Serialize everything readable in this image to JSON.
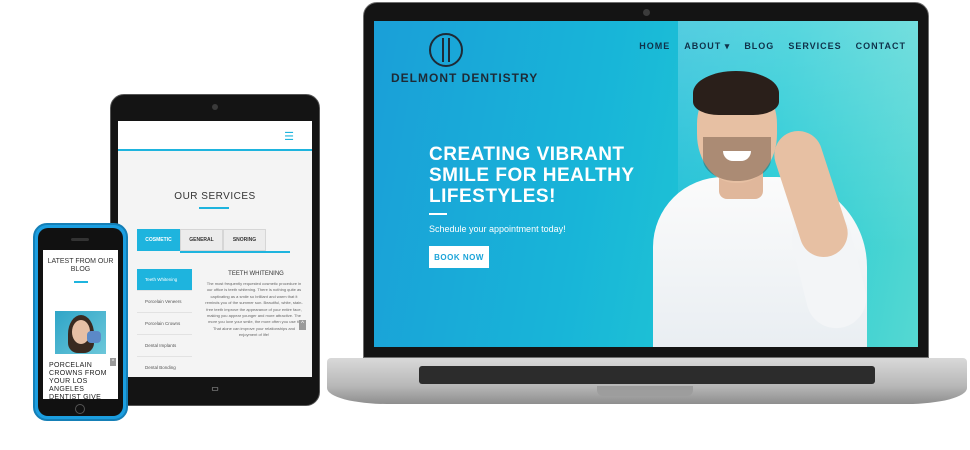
{
  "laptop": {
    "brand": "DELMONT DENTISTRY",
    "nav": [
      "HOME",
      "ABOUT ▾",
      "BLOG",
      "SERVICES",
      "CONTACT"
    ],
    "hero_title": "CREATING VIBRANT SMILE FOR HEALTHY LIFESTYLES!",
    "hero_subtitle": "Schedule your appointment today!",
    "cta_label": "BOOK NOW"
  },
  "tablet": {
    "menu_icon": "☰",
    "section_title": "OUR SERVICES",
    "tabs": [
      "COSMETIC",
      "GENERAL",
      "SNORING"
    ],
    "services": [
      "Teeth Whitening",
      "Porcelain Veneers",
      "Porcelain Crowns",
      "Dental Implants",
      "Dental Bonding"
    ],
    "service_heading": "TEETH WHITENING",
    "service_body": "The most frequently requested cosmetic procedure in our office is teeth whitening. There is nothing quite as captivating as a smile so brilliant and warm that it reminds you of the summer sun. Beautiful, white, stain-free teeth improve the appearance of your entire face, making you appear younger and more attractive. The more you love your smile, the more often you use it. That alone can improve your relationships and enjoyment of life!",
    "scroll_icon": "^"
  },
  "phone": {
    "section_title": "LATEST FROM OUR BLOG",
    "post_title": "PORCELAIN CROWNS FROM YOUR LOS ANGELES DENTIST GIVE",
    "scroll_icon": "^"
  },
  "colors": {
    "accent": "#1eb4de",
    "hero_start": "#1a9fd8",
    "hero_end": "#55d8d2",
    "phone_body": "#1b9ee0"
  }
}
